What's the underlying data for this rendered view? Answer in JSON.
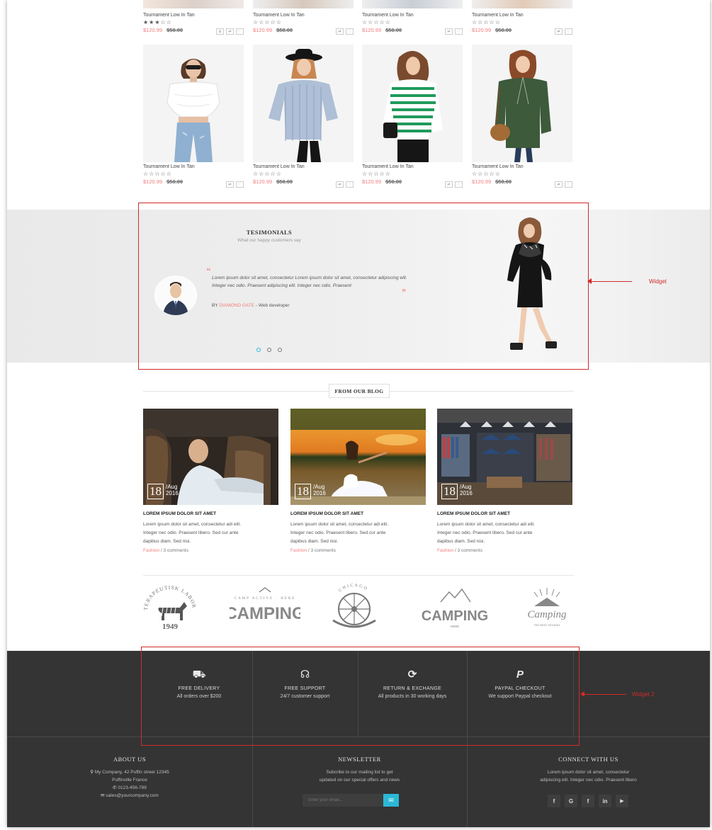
{
  "products_top": [
    {
      "name": "Tournament Low In Tan",
      "stars": "★★★☆☆",
      "price_new": "$120.99",
      "price_old": "$50.00"
    },
    {
      "name": "Tournament Low In Tan",
      "stars": "☆☆☆☆☆",
      "price_new": "$120.99",
      "price_old": "$50.00"
    },
    {
      "name": "Tournament Low In Tan",
      "stars": "☆☆☆☆☆",
      "price_new": "$120.99",
      "price_old": "$50.00"
    },
    {
      "name": "Tournament Low In Tan",
      "stars": "☆☆☆☆☆",
      "price_new": "$120.99",
      "price_old": "$50.00"
    }
  ],
  "products_bottom": [
    {
      "name": "Tournament Low In Tan",
      "stars": "☆☆☆☆☆",
      "price_new": "$120.99",
      "price_old": "$50.00"
    },
    {
      "name": "Tournament Low In Tan",
      "stars": "☆☆☆☆☆",
      "price_new": "$120.99",
      "price_old": "$50.00"
    },
    {
      "name": "Tournament Low In Tan",
      "stars": "☆☆☆☆☆",
      "price_new": "$120.99",
      "price_old": "$50.00"
    },
    {
      "name": "Tournament Low In Tan",
      "stars": "☆☆☆☆☆",
      "price_new": "$120.99",
      "price_old": "$50.00"
    }
  ],
  "testimonials": {
    "title": "TESIMONIALS",
    "subtitle": "What our happy customers say",
    "quote": "Lorem ipsum dolor sit amet, consectetur Lorem ipsum dolor sit amet, consectetur adipiscing elit. Integer nec odio. Praesent adipiscing elit. Integer nec odio. Praesent",
    "by_prefix": "BY",
    "author": "DIAMOND GATE",
    "role": "- Web developer"
  },
  "annotations": {
    "widget_label": "Widget",
    "widget2_label": "Widget 2"
  },
  "blog": {
    "heading": "FROM OUR BLOG",
    "posts": [
      {
        "day": "18",
        "month": "/Aug",
        "year": "2016",
        "title": "LOREM IPSUM DOLOR SIT AMET",
        "excerpt": "Lorem ipsum dolor sit amet, consectetur adi elit. Integer nec odio. Praesent libero. Sed cur ante dapibus diam. Sed nisi.",
        "category": "Fashion",
        "comments": "/ 3 comments"
      },
      {
        "day": "18",
        "month": "/Aug",
        "year": "2016",
        "title": "LOREM IPSUM DOLOR SIT AMET",
        "excerpt": "Lorem ipsum dolor sit amet, consectetur adi elit. Integer nec odio. Praesent libero. Sed cur ante dapibus diam. Sed nisi.",
        "category": "Fashion",
        "comments": "/ 3 comments"
      },
      {
        "day": "18",
        "month": "/Aug",
        "year": "2016",
        "title": "LOREM IPSUM DOLOR SIT AMET",
        "excerpt": "Lorem ipsum dolor sit amet, consectetur adi elit. Integer nec odio. Praesent libero. Sed cur ante dapibus diam. Sed nisi.",
        "category": "Fashion",
        "comments": "/ 3 comments"
      }
    ]
  },
  "brands": [
    {
      "name": "TERAPEUTISK LABORATORIUM",
      "sub": "1949"
    },
    {
      "name": "CAMPING",
      "sub": "CAMP ACTIVE · HERE"
    },
    {
      "name": "CHICAGO",
      "sub": ""
    },
    {
      "name": "CAMPING",
      "sub": "HERE"
    },
    {
      "name": "Camping",
      "sub": "THE BEST HOLIDAY"
    }
  ],
  "services": [
    {
      "icon": "truck-icon",
      "glyph": "⛟",
      "title": "FREE DELIVERY",
      "sub": "All orders over $200"
    },
    {
      "icon": "headset-icon",
      "glyph": "☊",
      "title": "FREE SUPPORT",
      "sub": "24/7 customer support"
    },
    {
      "icon": "refresh-icon",
      "glyph": "⟳",
      "title": "RETURN & EXCHANGE",
      "sub": "All products in 30 working days"
    },
    {
      "icon": "paypal-icon",
      "glyph": "P",
      "title": "PAYPAL CHECKOUT",
      "sub": "We support Paypal checkout"
    }
  ],
  "footer": {
    "about": {
      "title": "ABOUT US",
      "address1": "My Company, 42 Puffin street 12345",
      "address2": "Puffinville France",
      "phone": "0123-456-789",
      "email": "sales@yourcompany.com"
    },
    "newsletter": {
      "title": "NEWSLETTER",
      "line1": "Subcribe to our mailing list to get",
      "line2": "updated on our special offers and news",
      "placeholder": "Enter your email..."
    },
    "connect": {
      "title": "CONNECT WITH US",
      "line1": "Lorem ipsum dolor sit amet, consectetur",
      "line2": "adipiscing elit. Integer nec odio. Praesent libero",
      "social": [
        "f",
        "G",
        "f",
        "in",
        "▶"
      ]
    }
  },
  "colors": {
    "accent": "#2bb8d6",
    "price": "#f37c7c",
    "footer_bg": "#343434",
    "annotation": "#d12a2a"
  }
}
